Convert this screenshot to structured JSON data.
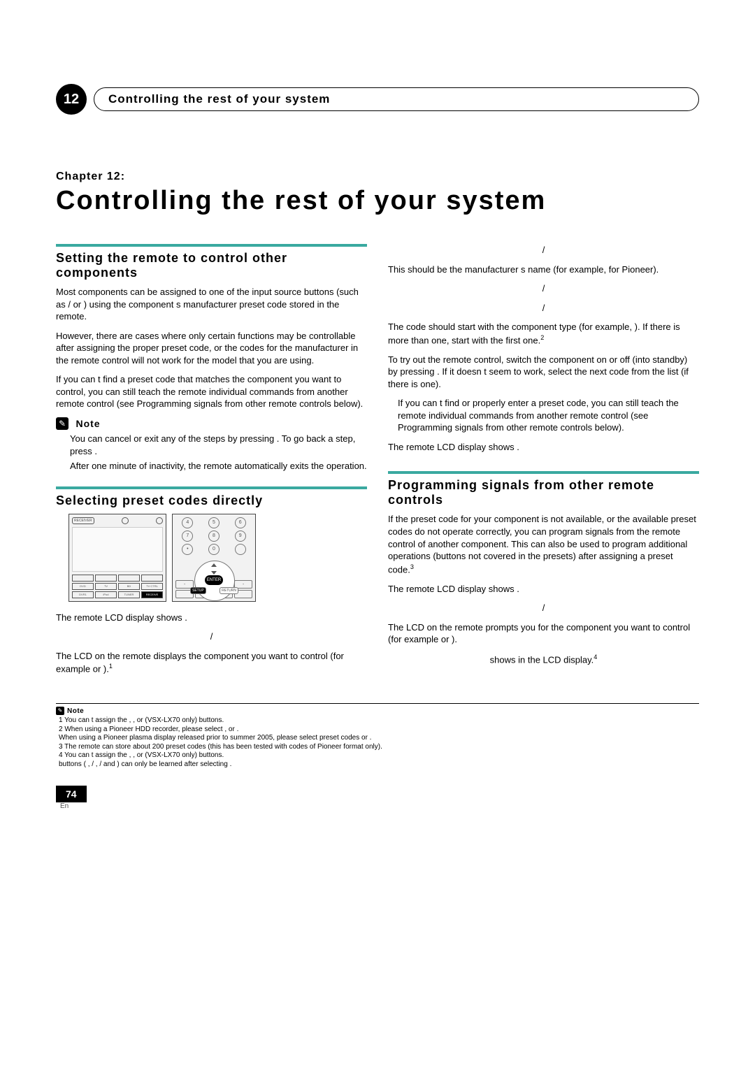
{
  "header": {
    "chapterNumber": "12",
    "runningTitle": "Controlling the rest of your system"
  },
  "chapter": {
    "label": "Chapter 12:",
    "title": "Controlling the rest of your system"
  },
  "left": {
    "sec1": {
      "title": "Setting the remote to control other components",
      "p1": "Most components can be assigned to one of the input source buttons (such as        /     or        ) using the component s manufacturer preset code stored in the remote.",
      "p2": "However, there are cases where only certain functions may be controllable after assigning the proper preset code, or the codes for the manufacturer in the remote control will not work for the model that you are using.",
      "p3": "If you can t find a preset code that matches the component you want to control, you can still teach the remote individual commands from another remote control (see Programming signals from other remote controls below).",
      "noteLabel": "Note",
      "note1": "You can cancel or exit any of the steps by pressing            . To go back a step, press           .",
      "note2": "After one minute of inactivity, the remote automatically exits the operation."
    },
    "sec2": {
      "title": "Selecting preset codes directly",
      "p1": "The remote LCD display shows        .",
      "p2": "/",
      "p3": "The LCD on the remote displays the component you want to control (for example         or       ).",
      "sup1": "1",
      "fig": {
        "receiver": "RECEIVER",
        "enter": "ENTER",
        "setup": "SETUP",
        "return": "RETURN",
        "num4": "4",
        "num5": "5",
        "num6": "6",
        "num7": "7",
        "num8": "8",
        "num9": "9",
        "grid": {
          "dvd": "DVD",
          "tv": "TV",
          "bd": "BD",
          "tvctl": "TV CTRL",
          "dvr1": "DVR1",
          "ipod": "iPod",
          "tuner": "TUNER",
          "recvr": "RECEIVE"
        }
      }
    }
  },
  "right": {
    "r1": "/",
    "r2": "This should be the manufacturer s name (for example, for Pioneer).",
    "r3": "/",
    "r4": "/",
    "r5a": "The code should start with the component type (for example,              ). If there is more than one, start with the first one.",
    "sup2": "2",
    "r6": "To try out the remote control, switch the component on or off (into standby) by pressing               . If it doesn t seem to work, select the next code from the list (if there is one).",
    "r7": "If you can t find or properly enter a preset code, you can still teach the remote individual commands from another remote control (see Programming signals from other remote controls below).",
    "r8": "The remote LCD display shows        .",
    "sec3": {
      "title": "Programming signals from other remote controls",
      "p1": "If the preset code for your component is not available, or the available preset codes do not operate correctly, you can program signals from the remote control of another component. This can also be used to program additional operations (buttons not covered in the presets) after assigning a preset code.",
      "sup3": "3",
      "p2": "The remote LCD display shows        .",
      "p3": "/",
      "p4": "The LCD on the remote prompts you for the component you want to control (for example          or       ).",
      "p5": "shows in the LCD display.",
      "sup4": "4"
    }
  },
  "footnotes": {
    "label": "Note",
    "n1": "1  You can t assign the            ,         ,         or                       (VSX-LX70 only) buttons.",
    "n2": "2   When using a Pioneer HDD recorder, please select                          ,         or        .",
    "n2b": "    When using a Pioneer plasma display released prior to summer 2005, please select preset codes         or        .",
    "n3": "3  The remote can store about 200 preset codes (this has been tested with codes of Pioneer format only).",
    "n4a": "4   You can t assign the              ,         ,         or                       (VSX-LX70 only) buttons.",
    "n4b": "                    buttons (       ,            /  ,           /   and               ) can only be learned after selecting             ."
  },
  "pagenum": {
    "num": "74",
    "lang": "En"
  }
}
